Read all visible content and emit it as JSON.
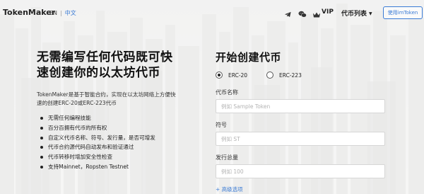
{
  "header": {
    "brand": "TokenMaker",
    "lang_en": "EN",
    "lang_sep": "|",
    "lang_zh": "中文",
    "icons": [
      "telegram-icon",
      "wechat-icon",
      "crown-icon"
    ],
    "vip": "VIP",
    "coin_list": "代币列表",
    "use_button": "使用imToken"
  },
  "intro": {
    "headline_line1": "无需编写任何代码既可快",
    "headline_line2": "速创建你的以太坊代币",
    "description": "TokenMaker是基于智能合约，实现在以太坊网络上方便快速的创建ERC-20或ERC-223代币",
    "features": [
      "无需任何编程技能",
      "百分百拥有代币的所有权",
      "自定义代币名称、符号、发行量，是否可增发",
      "代币合约源代码自动发布和验证通过",
      "代币转移时增加安全性检查",
      "支持Mainnet，Ropsten Testnet"
    ]
  },
  "form": {
    "title": "开始创建代币",
    "standard_options": [
      "ERC-20",
      "ERC-223"
    ],
    "selected_standard": "ERC-20",
    "name_label": "代币名称",
    "name_placeholder": "例如 Sample Token",
    "symbol_label": "符号",
    "symbol_placeholder": "例如 ST",
    "supply_label": "发行总量",
    "supply_placeholder": "例如 100",
    "advanced": "+ 高级选项"
  },
  "colors": {
    "accent": "#3a7bd5",
    "text": "#111111"
  }
}
